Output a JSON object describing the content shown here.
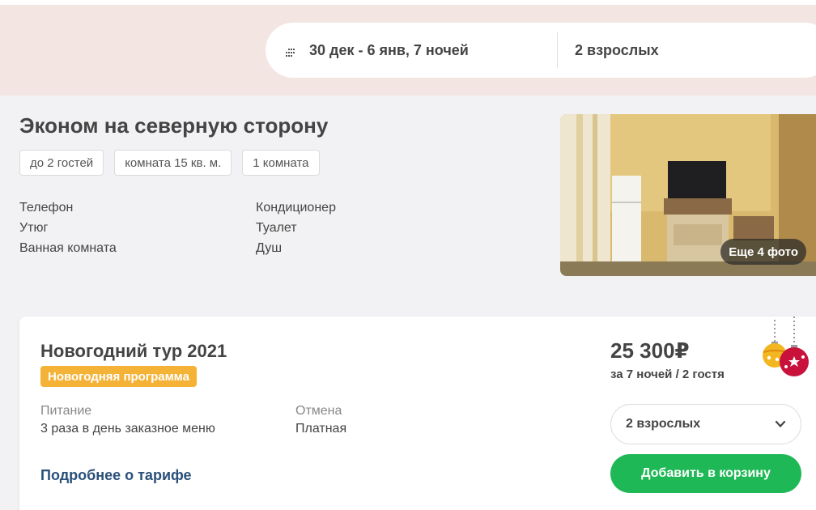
{
  "search": {
    "dates": "30 дек - 6 янв, 7 ночей",
    "guests": "2 взрослых",
    "icon": "calendar-icon"
  },
  "room": {
    "title": "Эконом на северную сторону",
    "tags": [
      "до 2 гостей",
      "комната 15 кв. м.",
      "1 комната"
    ],
    "amenities_col1": [
      "Телефон",
      "Утюг",
      "Ванная комната"
    ],
    "amenities_col2": [
      "Кондиционер",
      "Туалет",
      "Душ"
    ],
    "more_photos": "Еще 4 фото"
  },
  "tariff": {
    "name": "Новогодний тур 2021",
    "badge": "Новогодняя программа",
    "meal_label": "Питание",
    "meal_value": "3 раза в день заказное меню",
    "cancel_label": "Отмена",
    "cancel_value": "Платная",
    "more_link": "Подробнее о тарифе",
    "price": "25 300₽",
    "price_note": "за 7 ночей / 2 гостя",
    "guest_select": "2 взрослых",
    "add_to_cart": "Добавить в корзину"
  },
  "colors": {
    "header_bg": "#f3e5e1",
    "badge": "#f4b237",
    "cta": "#1fb856",
    "link": "#2a5079"
  }
}
